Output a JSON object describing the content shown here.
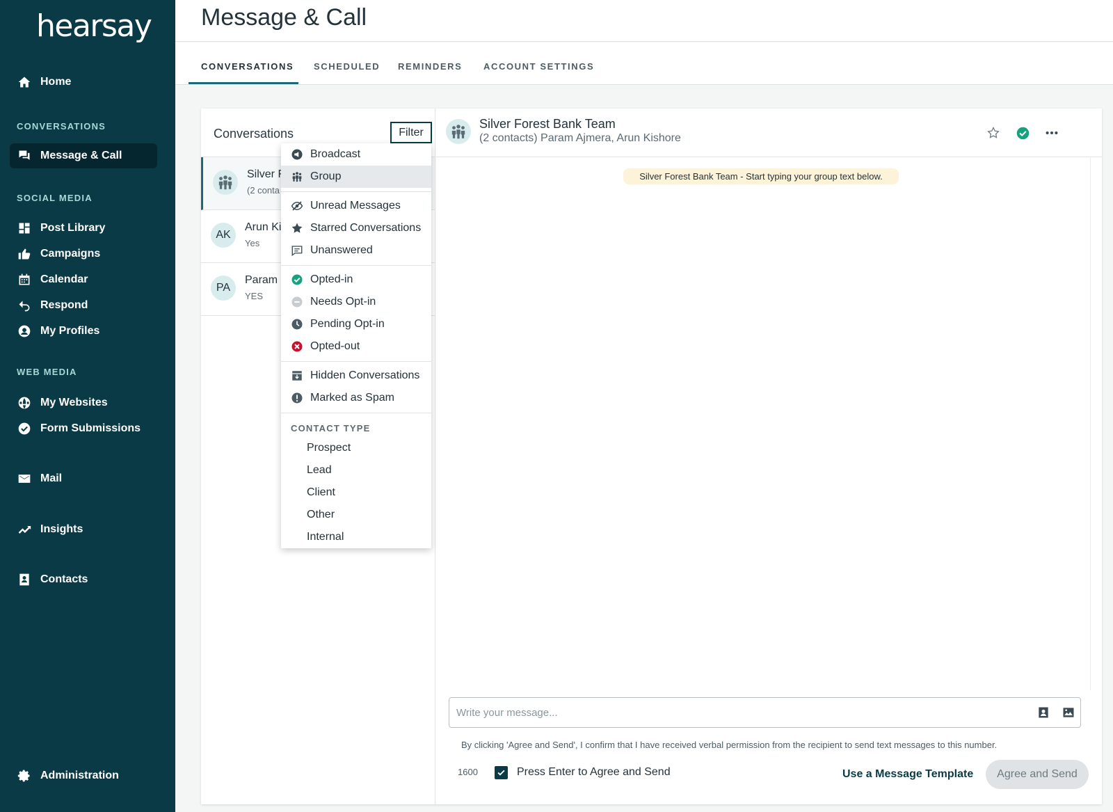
{
  "sidebar": {
    "logo": "hearsay",
    "home": "Home",
    "sections": {
      "conversations": "CONVERSATIONS",
      "social_media": "SOCIAL MEDIA",
      "web_media": "WEB MEDIA"
    },
    "items": {
      "message_call": "Message & Call",
      "post_library": "Post Library",
      "campaigns": "Campaigns",
      "calendar": "Calendar",
      "respond": "Respond",
      "my_profiles": "My Profiles",
      "my_websites": "My Websites",
      "form_submissions": "Form Submissions",
      "mail": "Mail",
      "insights": "Insights",
      "contacts": "Contacts",
      "administration": "Administration"
    }
  },
  "header": {
    "title": "Message & Call"
  },
  "tabs": [
    "CONVERSATIONS",
    "SCHEDULED",
    "REMINDERS",
    "ACCOUNT SETTINGS"
  ],
  "conversations": {
    "title": "Conversations",
    "filter_label": "Filter",
    "rows": [
      {
        "name": "Silver F",
        "sub": "(2 conta",
        "avatar": "group-icon"
      },
      {
        "name": "Arun Ki",
        "sub": "Yes",
        "initials": "AK"
      },
      {
        "name": "Param",
        "sub": "YES",
        "initials": "PA"
      }
    ]
  },
  "filter_menu": {
    "type_items": [
      "Broadcast",
      "Group"
    ],
    "status_items": [
      "Unread Messages",
      "Starred Conversations",
      "Unanswered"
    ],
    "optin_items": [
      "Opted-in",
      "Needs Opt-in",
      "Pending Opt-in",
      "Opted-out"
    ],
    "hidden_items": [
      "Hidden Conversations",
      "Marked as Spam"
    ],
    "contact_type_label": "CONTACT TYPE",
    "contact_types": [
      "Prospect",
      "Lead",
      "Client",
      "Other",
      "Internal"
    ]
  },
  "chat": {
    "name": "Silver Forest Bank Team",
    "sub": "(2 contacts) Param Ajmera, Arun Kishore",
    "system_message": "Silver Forest Bank Team - Start typing your group text below.",
    "input_placeholder": "Write your message...",
    "consent": "By clicking 'Agree and Send', I confirm that I have received verbal permission from the recipient to send text messages to this number.",
    "char_count": "1600",
    "enter_label": "Press Enter to Agree and Send",
    "template_link": "Use a Message Template",
    "send_label": "Agree and Send"
  },
  "colors": {
    "sidebar_bg": "#0b3a47",
    "accent": "#1a6a78",
    "opted_in": "#15a37f",
    "opted_out": "#c8102e"
  }
}
